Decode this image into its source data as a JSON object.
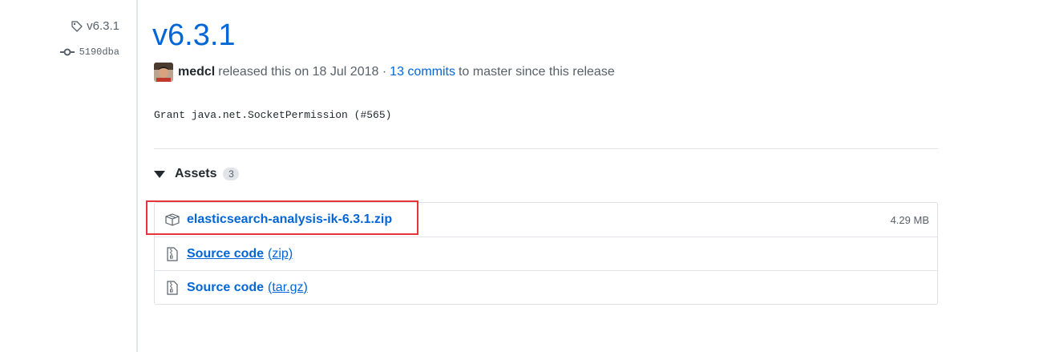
{
  "sidebar": {
    "tag_icon": "tag-icon",
    "tag": "v6.3.1",
    "commit_icon": "git-commit-icon",
    "commit": "5190dba"
  },
  "release": {
    "title": "v6.3.1",
    "author": "medcl",
    "released_text": "released this on 18 Jul 2018 ·",
    "commits_link": "13 commits",
    "branch_text": "to master since this release",
    "notes": "Grant java.net.SocketPermission (#565)"
  },
  "assets": {
    "heading": "Assets",
    "count": "3",
    "items": [
      {
        "icon": "package-icon",
        "name": "elasticsearch-analysis-ik-6.3.1.zip",
        "size": "4.29 MB"
      },
      {
        "icon": "file-zip-icon",
        "label": "Source code",
        "format": "(zip)"
      },
      {
        "icon": "file-zip-icon",
        "label": "Source code",
        "format": "(tar.gz)"
      }
    ]
  },
  "colors": {
    "link": "#0366d6",
    "muted": "#586069",
    "highlight": "#e5343a"
  }
}
